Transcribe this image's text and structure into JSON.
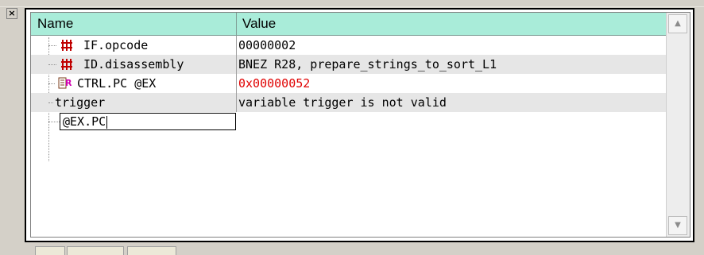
{
  "panel": {
    "close_glyph": "×",
    "columns": {
      "name": "Name",
      "value": "Value"
    }
  },
  "rows": [
    {
      "name": "IF.opcode",
      "value": "00000002",
      "icon": "signal-bus-icon",
      "value_color": "#000000"
    },
    {
      "name": "ID.disassembly",
      "value": "BNEZ R28, prepare_strings_to_sort_L1",
      "icon": "signal-bus-icon",
      "value_color": "#000000"
    },
    {
      "name": "CTRL.PC @EX",
      "value": "0x00000052",
      "icon": "register-icon",
      "value_color": "#e00000"
    },
    {
      "name": "trigger",
      "value": "variable trigger is not valid",
      "icon": "",
      "value_color": "#000000"
    }
  ],
  "edit": {
    "value": "@EX.PC"
  },
  "scrollbar": {
    "up_glyph": "▲",
    "down_glyph": "▼"
  }
}
